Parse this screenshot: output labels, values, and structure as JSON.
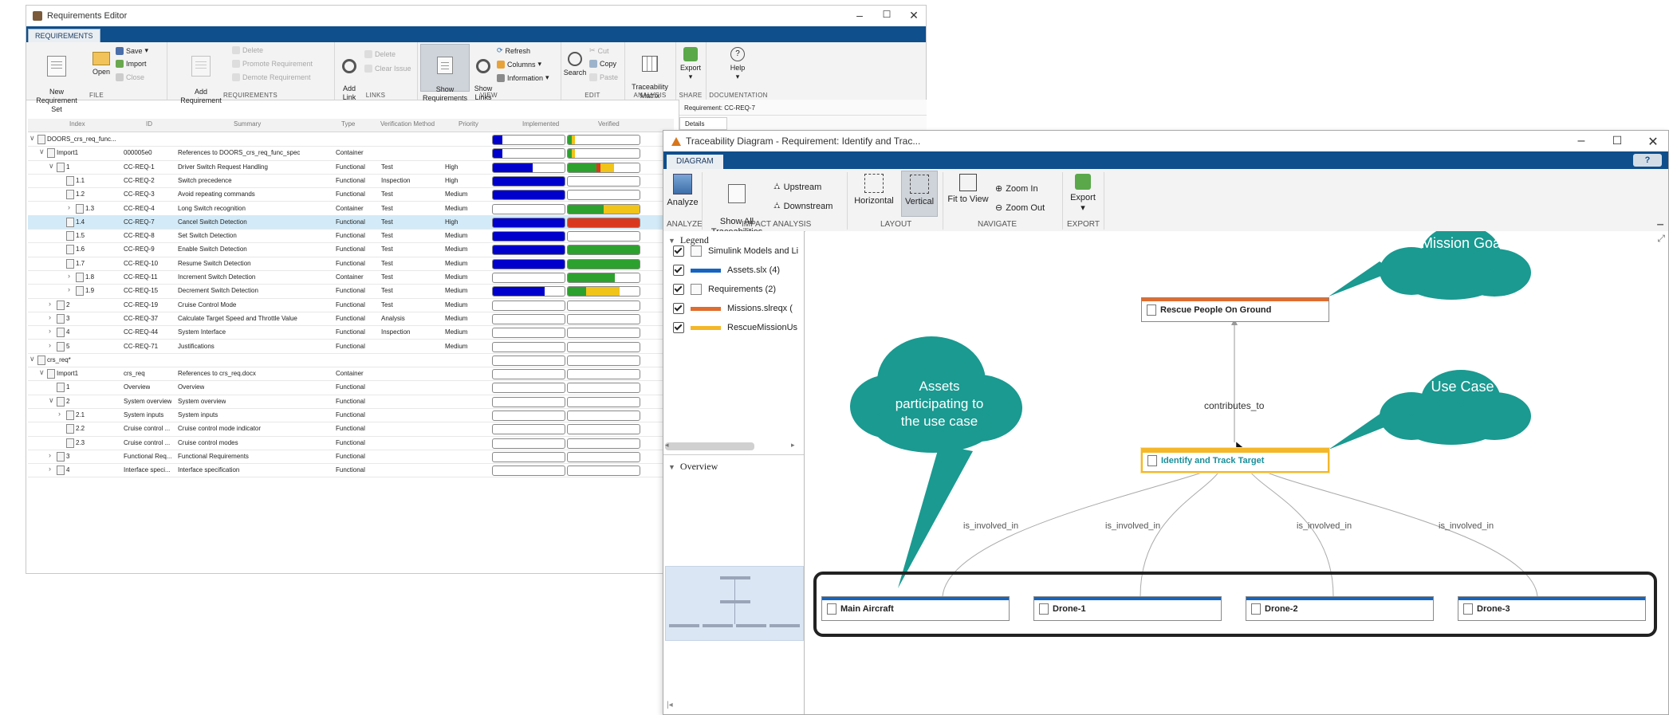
{
  "req_editor": {
    "title": "Requirements Editor",
    "tab": "REQUIREMENTS",
    "ribbon": {
      "new_req_set": "New\nRequirement Set",
      "open": "Open",
      "save": "Save",
      "import": "Import",
      "close": "Close",
      "file_group": "FILE",
      "add_requirement": "Add\nRequirement",
      "delete": "Delete",
      "promote": "Promote Requirement",
      "demote": "Demote Requirement",
      "requirements_group": "REQUIREMENTS",
      "add_link": "Add\nLink",
      "link_delete": "Delete",
      "clear_issue": "Clear Issue",
      "links_group": "LINKS",
      "show_requirements": "Show\nRequirements",
      "show_links": "Show\nLinks",
      "refresh": "Refresh",
      "columns": "Columns",
      "information": "Information",
      "view_group": "VIEW",
      "search": "Search",
      "cut": "Cut",
      "copy": "Copy",
      "paste": "Paste",
      "edit_group": "EDIT",
      "traceability_matrix": "Traceability\nMatrix",
      "analysis_group": "ANALYSIS",
      "export": "Export",
      "share_group": "SHARE",
      "help": "Help",
      "documentation_group": "DOCUMENTATION"
    },
    "columns": [
      "Index",
      "ID",
      "Summary",
      "Type",
      "Verification Method",
      "Priority",
      "Implemented",
      "Verified"
    ],
    "rows": [
      {
        "index": "DOORS_crs_req_func...",
        "id": "",
        "summary": "",
        "type": "",
        "vm": "",
        "priority": "",
        "impl": [
          [
            0.13,
            "#0000cc"
          ]
        ],
        "ver": [
          [
            0.05,
            "#2da12d"
          ],
          [
            0.05,
            "#f0c419"
          ]
        ]
      },
      {
        "index": "Import1",
        "id": "000005e0",
        "summary": "References to DOORS_crs_req_func_spec",
        "type": "Container",
        "vm": "",
        "priority": "",
        "impl": [
          [
            0.13,
            "#0000cc"
          ]
        ],
        "ver": [
          [
            0.05,
            "#2da12d"
          ],
          [
            0.05,
            "#f0c419"
          ]
        ]
      },
      {
        "index": "1",
        "id": "CC-REQ-1",
        "summary": "Driver Switch Request Handling",
        "type": "Functional",
        "vm": "Test",
        "priority": "High",
        "impl": [
          [
            0.55,
            "#0000cc"
          ]
        ],
        "ver": [
          [
            0.4,
            "#2da12d"
          ],
          [
            0.06,
            "#d9381e"
          ],
          [
            0.18,
            "#f0c419"
          ]
        ]
      },
      {
        "index": "1.1",
        "id": "CC-REQ-2",
        "summary": "Switch precedence",
        "type": "Functional",
        "vm": "Inspection",
        "priority": "High",
        "impl": [
          [
            1,
            "#0000cc"
          ]
        ],
        "ver": []
      },
      {
        "index": "1.2",
        "id": "CC-REQ-3",
        "summary": "Avoid repeating commands",
        "type": "Functional",
        "vm": "Test",
        "priority": "Medium",
        "impl": [
          [
            1,
            "#0000cc"
          ]
        ],
        "ver": []
      },
      {
        "index": "1.3",
        "id": "CC-REQ-4",
        "summary": "Long Switch recognition",
        "type": "Container",
        "vm": "Test",
        "priority": "Medium",
        "impl": [],
        "ver": [
          [
            0.5,
            "#2da12d"
          ],
          [
            0.5,
            "#f0c419"
          ]
        ]
      },
      {
        "index": "1.4",
        "id": "CC-REQ-7",
        "summary": "Cancel Switch Detection",
        "type": "Functional",
        "vm": "Test",
        "priority": "High",
        "impl": [
          [
            1,
            "#0000cc"
          ]
        ],
        "ver": [
          [
            1,
            "#d9381e"
          ]
        ],
        "selected": true
      },
      {
        "index": "1.5",
        "id": "CC-REQ-8",
        "summary": "Set Switch Detection",
        "type": "Functional",
        "vm": "Test",
        "priority": "Medium",
        "impl": [
          [
            1,
            "#0000cc"
          ]
        ],
        "ver": []
      },
      {
        "index": "1.6",
        "id": "CC-REQ-9",
        "summary": "Enable Switch Detection",
        "type": "Functional",
        "vm": "Test",
        "priority": "Medium",
        "impl": [
          [
            1,
            "#0000cc"
          ]
        ],
        "ver": [
          [
            1,
            "#2da12d"
          ]
        ]
      },
      {
        "index": "1.7",
        "id": "CC-REQ-10",
        "summary": "Resume Switch Detection",
        "type": "Functional",
        "vm": "Test",
        "priority": "Medium",
        "impl": [
          [
            1,
            "#0000cc"
          ]
        ],
        "ver": [
          [
            1,
            "#2da12d"
          ]
        ]
      },
      {
        "index": "1.8",
        "id": "CC-REQ-11",
        "summary": "Increment Switch Detection",
        "type": "Container",
        "vm": "Test",
        "priority": "Medium",
        "impl": [],
        "ver": [
          [
            0.66,
            "#2da12d"
          ]
        ]
      },
      {
        "index": "1.9",
        "id": "CC-REQ-15",
        "summary": "Decrement Switch Detection",
        "type": "Functional",
        "vm": "Test",
        "priority": "Medium",
        "impl": [
          [
            0.72,
            "#0000cc"
          ]
        ],
        "ver": [
          [
            0.25,
            "#2da12d"
          ],
          [
            0.47,
            "#f0c419"
          ]
        ]
      },
      {
        "index": "2",
        "id": "CC-REQ-19",
        "summary": "Cruise Control Mode",
        "type": "Functional",
        "vm": "Test",
        "priority": "Medium",
        "impl": [],
        "ver": []
      },
      {
        "index": "3",
        "id": "CC-REQ-37",
        "summary": "Calculate Target Speed and Throttle Value",
        "type": "Functional",
        "vm": "Analysis",
        "priority": "Medium",
        "impl": [],
        "ver": []
      },
      {
        "index": "4",
        "id": "CC-REQ-44",
        "summary": "System Interface",
        "type": "Functional",
        "vm": "Inspection",
        "priority": "Medium",
        "impl": [],
        "ver": []
      },
      {
        "index": "5",
        "id": "CC-REQ-71",
        "summary": "Justifications",
        "type": "Functional",
        "vm": "",
        "priority": "Medium",
        "impl": [],
        "ver": []
      },
      {
        "index": "crs_req*",
        "id": "",
        "summary": "",
        "type": "",
        "vm": "",
        "priority": "",
        "impl": [],
        "ver": []
      },
      {
        "index": "Import1",
        "id": "crs_req",
        "summary": "References to crs_req.docx",
        "type": "Container",
        "vm": "",
        "priority": "",
        "impl": [],
        "ver": []
      },
      {
        "index": "1",
        "id": "Overview",
        "summary": "Overview",
        "type": "Functional",
        "vm": "",
        "priority": "",
        "impl": [],
        "ver": []
      },
      {
        "index": "2",
        "id": "System overview",
        "summary": "System overview",
        "type": "Functional",
        "vm": "",
        "priority": "",
        "impl": [],
        "ver": []
      },
      {
        "index": "2.1",
        "id": "System inputs",
        "summary": "System inputs",
        "type": "Functional",
        "vm": "",
        "priority": "",
        "impl": [],
        "ver": []
      },
      {
        "index": "2.2",
        "id": "Cruise control ...",
        "summary": "Cruise control mode indicator",
        "type": "Functional",
        "vm": "",
        "priority": "",
        "impl": [],
        "ver": []
      },
      {
        "index": "2.3",
        "id": "Cruise control ...",
        "summary": "Cruise control modes",
        "type": "Functional",
        "vm": "",
        "priority": "",
        "impl": [],
        "ver": []
      },
      {
        "index": "3",
        "id": "Functional Req...",
        "summary": "Functional Requirements",
        "type": "Functional",
        "vm": "",
        "priority": "",
        "impl": [],
        "ver": []
      },
      {
        "index": "4",
        "id": "Interface speci...",
        "summary": "Interface specification",
        "type": "Functional",
        "vm": "",
        "priority": "",
        "impl": [],
        "ver": []
      }
    ],
    "right_panel": {
      "requirement": "Requirement: CC-REQ-7",
      "details_tab": "Details"
    }
  },
  "trace": {
    "title": "Traceability Diagram - Requirement: Identify and Trac...",
    "tab": "DIAGRAM",
    "help": "?",
    "ribbon": {
      "analyze": "Analyze",
      "analyze_group": "ANALYZE",
      "show_all": "Show All\nTraceabilities",
      "upstream": "Upstream",
      "downstream": "Downstream",
      "impact_group": "IMPACT ANALYSIS",
      "horizontal": "Horizontal",
      "vertical": "Vertical",
      "layout_group": "LAYOUT",
      "fit_to_view": "Fit to View",
      "zoom_in": "Zoom In",
      "zoom_out": "Zoom Out",
      "navigate_group": "NAVIGATE",
      "export": "Export",
      "export_group": "EXPORT"
    },
    "legend": {
      "title": "Legend",
      "items": [
        {
          "label": "Simulink Models and Li",
          "swatch": null
        },
        {
          "label": "Assets.slx (4)",
          "swatch": "#1565c0"
        },
        {
          "label": "Requirements (2)",
          "swatch": null
        },
        {
          "label": "Missions.slreqx (",
          "swatch": "#e06c2e"
        },
        {
          "label": "RescueMissionUs",
          "swatch": "#f4b728"
        }
      ]
    },
    "overview_title": "Overview",
    "nodes": {
      "top": "Rescue People On Ground",
      "mid": "Identify and Track Target",
      "b1": "Main Aircraft",
      "b2": "Drone-1",
      "b3": "Drone-2",
      "b4": "Drone-3"
    },
    "edges": {
      "contributes": "contributes_to",
      "involved": "is_involved_in"
    },
    "callouts": {
      "mission": "Mission Goal",
      "usecase": "Use Case",
      "assets": "Assets\nparticipating to\nthe use case"
    },
    "colors": {
      "teal": "#1a9a91",
      "orange": "#e06c2e",
      "blue": "#1565c0",
      "yellow": "#f4b728"
    }
  }
}
